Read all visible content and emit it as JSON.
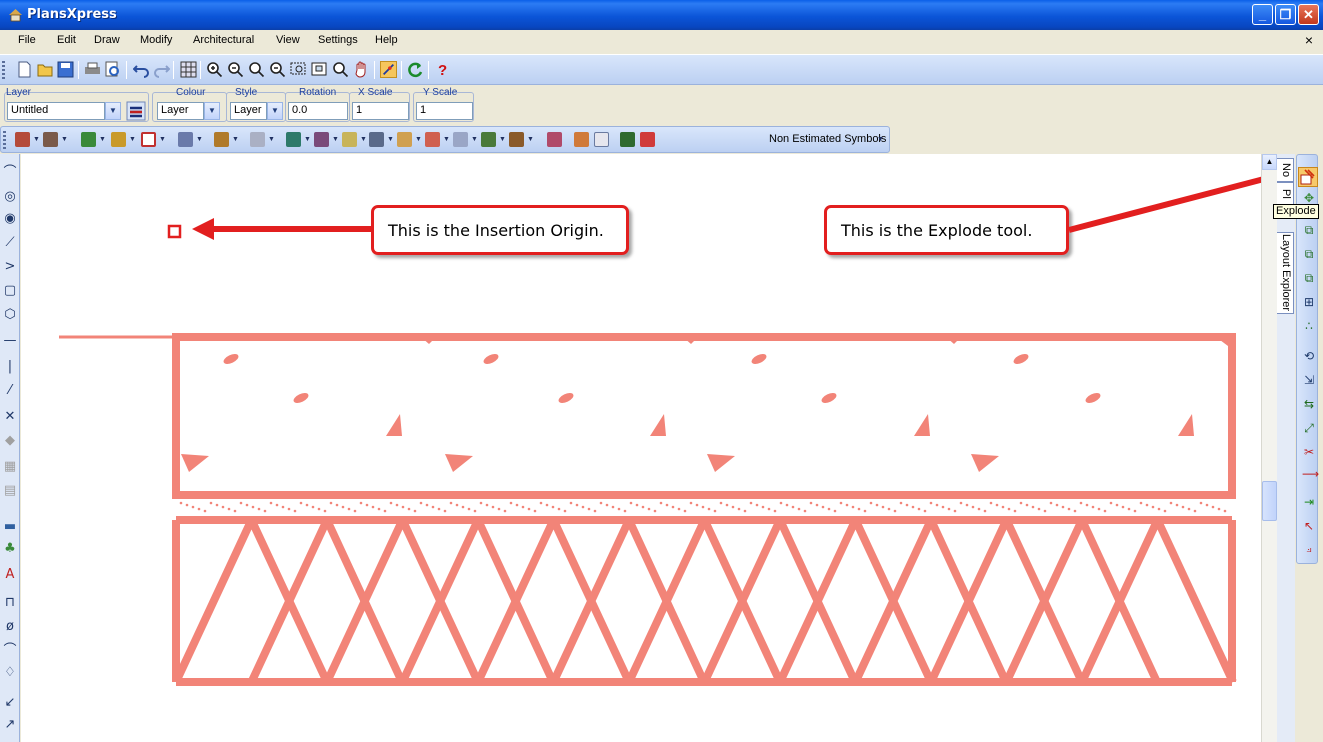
{
  "window": {
    "title": "PlansXpress",
    "min_label": "_",
    "max_label": "❐",
    "close_label": "✕"
  },
  "menu": [
    "File",
    "Edit",
    "Draw",
    "Modify",
    "Architectural",
    "View",
    "Settings",
    "Help"
  ],
  "doc_close": "×",
  "props": {
    "layer_label": "Layer",
    "layer_value": "Untitled",
    "colour_label": "Colour",
    "colour_value": "Layer",
    "style_label": "Style",
    "style_value": "Layer",
    "rotation_label": "Rotation",
    "rotation_value": "0.0",
    "xscale_label": "X Scale",
    "xscale_value": "1",
    "yscale_label": "Y Scale",
    "yscale_value": "1"
  },
  "symbols_toolbar": {
    "non_estimated": "Non Estimated Symbols"
  },
  "side_tabs": {
    "tab1": "No",
    "tab2": "Pl",
    "layout_explorer": "Layout Explorer"
  },
  "tooltip": "Explode",
  "callouts": {
    "insertion": "This is the Insertion Origin.",
    "explode": "This is the Explode tool."
  },
  "colors": {
    "hatch_fill": "#f28478",
    "annotation_red": "#e21f1f",
    "titlebar_blue": "#0b55d8"
  }
}
